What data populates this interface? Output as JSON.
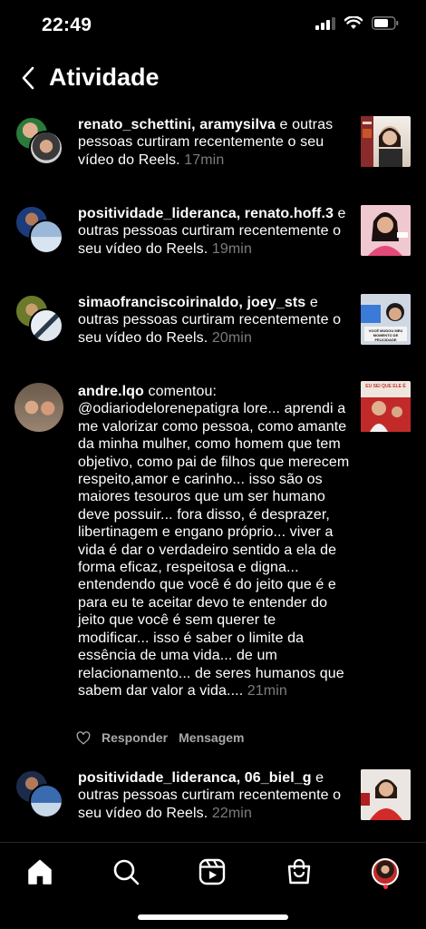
{
  "status": {
    "time": "22:49"
  },
  "header": {
    "title": "Atividade"
  },
  "items": [
    {
      "users": "renato_schettini, aramysilva",
      "rest": " e outras pessoas curtiram recentemente o seu vídeo do Reels.",
      "time": "17min"
    },
    {
      "users": "positividade_lideranca, renato.hoff.3",
      "rest": " e outras pessoas curtiram recentemente o seu vídeo do Reels.",
      "time": "19min"
    },
    {
      "users": "simaofranciscoirinaldo, joey_sts",
      "rest": " e outras pessoas curtiram recentemente o seu vídeo do Reels.",
      "time": "20min"
    },
    {
      "users": "andre.lqo",
      "rest": " comentou: @odiariodelorenepatigra lore... aprendi a me valorizar como pessoa, como amante da minha mulher,  como homem que tem objetivo, como pai de filhos que merecem respeito,amor e carinho... isso são os maiores tesouros que um ser humano deve possuir... fora disso, é desprazer, libertinagem e engano próprio... viver a vida é dar o verdadeiro sentido a ela de forma eficaz, respeitosa e digna... entendendo que você é do jeito que é e para eu te aceitar devo te entender do jeito que você é sem querer te modificar... isso é saber o limite da essência de uma vida... de um relacionamento... de seres humanos que sabem dar valor a vida....",
      "time": "21min",
      "reply_label": "Responder",
      "message_label": "Mensagem"
    },
    {
      "users": "positividade_lideranca, 06_biel_g",
      "rest": " e outras pessoas curtiram recentemente o seu vídeo do Reels.",
      "time": "22min"
    }
  ],
  "thumb_captions": {
    "t3": "VOCÊ MUDOU MEU MOMENTO DE FELICIDADE",
    "t4": "EU SEI QUE ELE É"
  },
  "icons": [
    "back-icon",
    "heart-icon",
    "home-icon",
    "search-icon",
    "reels-icon",
    "shop-icon",
    "profile-avatar"
  ],
  "colors": {
    "background": "#000000",
    "text": "#ffffff",
    "muted": "#7c7c7c",
    "accent": "#ff3040"
  }
}
